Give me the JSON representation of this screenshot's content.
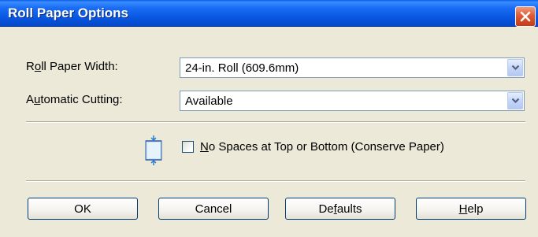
{
  "window": {
    "title": "Roll Paper Options"
  },
  "roll_paper_width": {
    "label_pre": "R",
    "label_accel": "o",
    "label_post": "ll Paper Width:",
    "value": "24-in. Roll (609.6mm)"
  },
  "automatic_cutting": {
    "label_pre": "A",
    "label_accel": "u",
    "label_post": "tomatic Cutting:",
    "value": "Available"
  },
  "no_spaces": {
    "label_accel": "N",
    "label_post": "o Spaces at Top or Bottom (Conserve Paper)",
    "checked": false
  },
  "buttons": {
    "ok": "OK",
    "cancel": "Cancel",
    "defaults_pre": "De",
    "defaults_accel": "f",
    "defaults_post": "aults",
    "help_accel": "H",
    "help_post": "elp"
  },
  "colors": {
    "titlebar": "#0856e0",
    "close_button": "#e05a33",
    "dialog_background": "#ece9d8"
  },
  "icons": [
    "close-icon",
    "chevron-down-icon",
    "roll-paper-icon"
  ]
}
